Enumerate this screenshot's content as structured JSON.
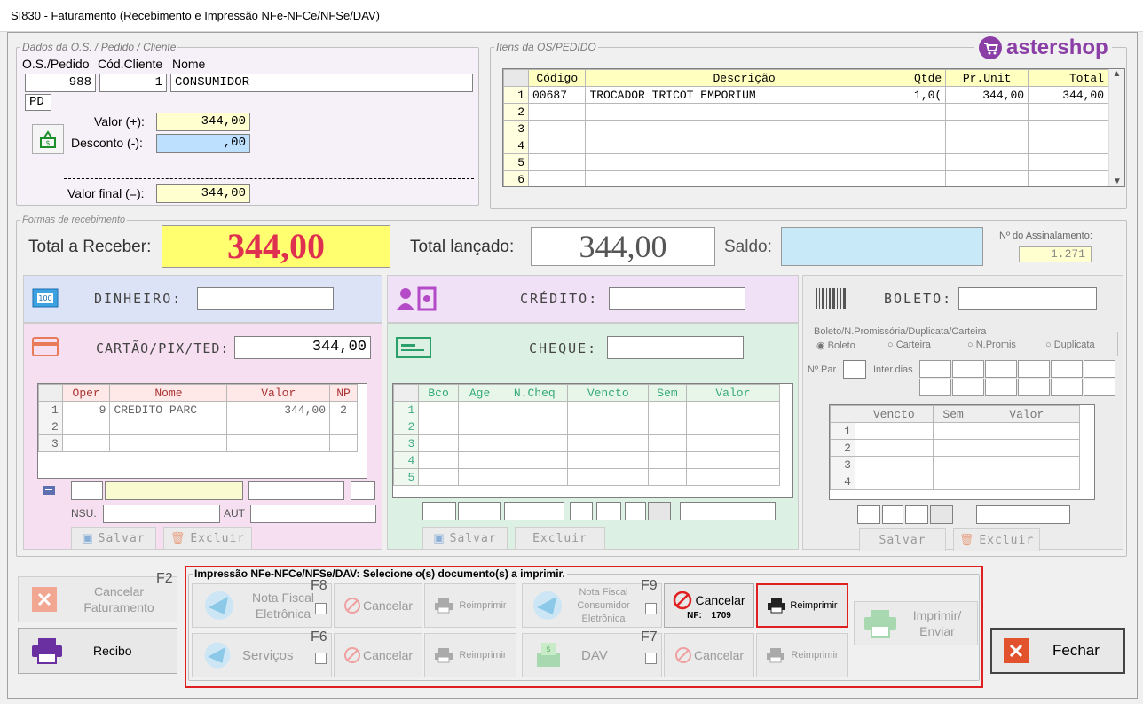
{
  "window": {
    "title": "SI830 - Faturamento (Recebimento e Impressão NFe-NFCe/NFSe/DAV)"
  },
  "brand": {
    "logo_text": "astershop",
    "color": "#8b3fa6"
  },
  "dados": {
    "legend": "Dados da O.S. / Pedido / Cliente",
    "col_pedido": "O.S./Pedido",
    "col_cliente": "Cód.Cliente",
    "col_nome": "Nome",
    "pedido": "988",
    "cliente": "1",
    "nome": "CONSUMIDOR",
    "tipo": "PD",
    "valor_label": "Valor (+):",
    "valor": "344,00",
    "desconto_label": "Desconto (-):",
    "desconto": ",00",
    "valor_final_label": "Valor final (=):",
    "valor_final": "344,00"
  },
  "itens": {
    "legend": "Itens da OS/PEDIDO",
    "headers": [
      "Código",
      "Descrição",
      "Qtde",
      "Pr.Unit",
      "Total"
    ],
    "rows": [
      {
        "n": "1",
        "codigo": "00687",
        "descricao": "TROCADOR TRICOT EMPORIUM",
        "qtde": "1,0(",
        "unit": "344,00",
        "total": "344,00"
      },
      {
        "n": "2",
        "codigo": "",
        "descricao": "",
        "qtde": "",
        "unit": "",
        "total": ""
      },
      {
        "n": "3",
        "codigo": "",
        "descricao": "",
        "qtde": "",
        "unit": "",
        "total": ""
      },
      {
        "n": "4",
        "codigo": "",
        "descricao": "",
        "qtde": "",
        "unit": "",
        "total": ""
      },
      {
        "n": "5",
        "codigo": "",
        "descricao": "",
        "qtde": "",
        "unit": "",
        "total": ""
      },
      {
        "n": "6",
        "codigo": "",
        "descricao": "",
        "qtde": "",
        "unit": "",
        "total": ""
      }
    ]
  },
  "formas": {
    "legend": "Formas de recebimento",
    "total_receber_label": "Total a Receber:",
    "total_receber": "344,00",
    "total_lancado_label": "Total lançado:",
    "total_lancado": "344,00",
    "saldo_label": "Saldo:",
    "saldo": "",
    "assinalamento_label": "Nº do Assinalamento:",
    "assinalamento": "1.271",
    "dinheiro_label": "DINHEIRO:",
    "cartao_label": "CARTÃO/PIX/TED:",
    "cartao_valor": "344,00",
    "credito_label": "CRÉDITO:",
    "cheque_label": "CHEQUE:",
    "boleto_label": "BOLETO:",
    "cartao_grid_headers": [
      "Oper",
      "Nome",
      "Valor",
      "NP"
    ],
    "cartao_rows": [
      {
        "n": "1",
        "oper": "9",
        "nome": "CREDITO PARC",
        "valor": "344,00",
        "np": "2"
      },
      {
        "n": "2",
        "oper": "",
        "nome": "",
        "valor": "",
        "np": ""
      },
      {
        "n": "3",
        "oper": "",
        "nome": "",
        "valor": "",
        "np": ""
      }
    ],
    "nsu_label": "NSU.",
    "aut_label": "AUT",
    "cheque_grid_headers": [
      "Bco",
      "Age",
      "N.Cheq",
      "Vencto",
      "Sem",
      "Valor"
    ],
    "cheque_rows": [
      "1",
      "2",
      "3",
      "4",
      "5"
    ],
    "boleto_group_label": "Boleto/N.Promissória/Duplicata/Carteira",
    "boleto_options": [
      "Boleto",
      "Carteira",
      "N.Promis",
      "Duplicata"
    ],
    "npar_label": "Nº.Par",
    "inter_dias_label": "Inter.dias",
    "boleto_grid_headers": [
      "Vencto",
      "Sem",
      "Valor"
    ],
    "boleto_rows": [
      "1",
      "2",
      "3",
      "4"
    ],
    "salvar_label": "Salvar",
    "excluir_label": "Excluir"
  },
  "impressao": {
    "legend": "Impressão NFe-NFCe/NFSe/DAV: Selecione o(s) documento(s) a imprimir.",
    "nfe_label": "Nota Fiscal Eletrônica",
    "nfe_key": "F8",
    "nfce_label": "Nota Fiscal Consumidor Eletrônica",
    "nfce_key": "F9",
    "servicos_label": "Serviços",
    "servicos_key": "F6",
    "dav_label": "DAV",
    "dav_key": "F7",
    "cancelar_label": "Cancelar",
    "reimprimir_label": "Reimprimir",
    "nf_label": "NF:",
    "nf_numero": "1709",
    "imprimir_enviar_label": "Imprimir/ Enviar"
  },
  "footer": {
    "cancelar_faturamento_label": "Cancelar Faturamento",
    "cancelar_faturamento_key": "F2",
    "recibo_label": "Recibo",
    "fechar_label": "Fechar"
  }
}
